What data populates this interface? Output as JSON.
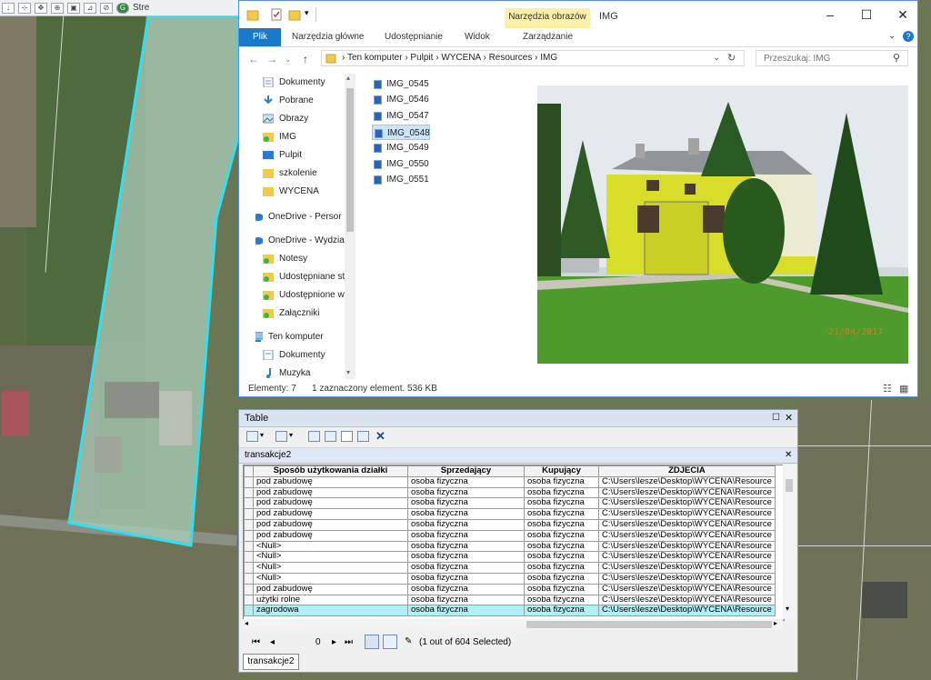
{
  "arcmap_toolbar": {
    "streetview_label": "Stre"
  },
  "explorer": {
    "title": "IMG",
    "context_tab": "Narzędzia obrazów",
    "ribbon_tabs": [
      "Plik",
      "Narzędzia główne",
      "Udostępnianie",
      "Widok",
      "Zarządzanie"
    ],
    "breadcrumb": [
      "Ten komputer",
      "Pulpit",
      "WYCENA",
      "Resources",
      "IMG"
    ],
    "search_placeholder": "Przeszukaj: IMG",
    "nav_items": [
      {
        "label": "Dokumenty",
        "icon": "documents-icon",
        "pinned": true
      },
      {
        "label": "Pobrane",
        "icon": "download-icon",
        "pinned": true
      },
      {
        "label": "Obrazy",
        "icon": "pictures-icon",
        "pinned": true
      },
      {
        "label": "IMG",
        "icon": "folder-sync-icon",
        "pinned": true
      },
      {
        "label": "Pulpit",
        "icon": "desktop-icon",
        "pinned": true
      },
      {
        "label": "szkolenie",
        "icon": "folder-icon",
        "pinned": false
      },
      {
        "label": "WYCENA",
        "icon": "folder-icon",
        "pinned": false
      },
      {
        "label": "OneDrive - Persor",
        "icon": "onedrive-icon",
        "pinned": false
      },
      {
        "label": "OneDrive - Wydzia",
        "icon": "onedrive-icon",
        "pinned": false
      },
      {
        "label": "Notesy",
        "icon": "folder-sync-icon",
        "pinned": false
      },
      {
        "label": "Udostępniane st",
        "icon": "folder-sync-icon",
        "pinned": false
      },
      {
        "label": "Udostępnione w",
        "icon": "folder-sync-icon",
        "pinned": false
      },
      {
        "label": "Załączniki",
        "icon": "folder-sync-icon",
        "pinned": false
      },
      {
        "label": "Ten komputer",
        "icon": "computer-icon",
        "pinned": false
      },
      {
        "label": "Dokumenty",
        "icon": "documents-icon",
        "pinned": false
      },
      {
        "label": "Muzyka",
        "icon": "music-icon",
        "pinned": false
      }
    ],
    "files": [
      "IMG_0545",
      "IMG_0546",
      "IMG_0547",
      "IMG_0548",
      "IMG_0549",
      "IMG_0550",
      "IMG_0551"
    ],
    "selected_file": "IMG_0548",
    "preview_date_stamp": "21/04/2017",
    "status_count": "Elementy: 7",
    "status_selected": "1 zaznaczony element. 536 KB"
  },
  "table_window": {
    "title": "Table",
    "layer_tab": "transakcje2",
    "columns": [
      "Sposób użytkowania działki",
      "Sprzedający",
      "Kupujący",
      "ZDJECIA"
    ],
    "rows": [
      [
        "pod zabudowę",
        "osoba fizyczna",
        "osoba fizyczna",
        "C:\\Users\\lesze\\Desktop\\WYCENA\\Resource"
      ],
      [
        "pod zabudowę",
        "osoba fizyczna",
        "osoba fizyczna",
        "C:\\Users\\lesze\\Desktop\\WYCENA\\Resource"
      ],
      [
        "pod zabudowę",
        "osoba fizyczna",
        "osoba fizyczna",
        "C:\\Users\\lesze\\Desktop\\WYCENA\\Resource"
      ],
      [
        "pod zabudowę",
        "osoba fizyczna",
        "osoba fizyczna",
        "C:\\Users\\lesze\\Desktop\\WYCENA\\Resource"
      ],
      [
        "pod zabudowę",
        "osoba fizyczna",
        "osoba fizyczna",
        "C:\\Users\\lesze\\Desktop\\WYCENA\\Resource"
      ],
      [
        "pod zabudowę",
        "osoba fizyczna",
        "osoba fizyczna",
        "C:\\Users\\lesze\\Desktop\\WYCENA\\Resource"
      ],
      [
        "<Null>",
        "osoba fizyczna",
        "osoba fizyczna",
        "C:\\Users\\lesze\\Desktop\\WYCENA\\Resource"
      ],
      [
        "<Null>",
        "osoba fizyczna",
        "osoba fizyczna",
        "C:\\Users\\lesze\\Desktop\\WYCENA\\Resource"
      ],
      [
        "<Null>",
        "osoba fizyczna",
        "osoba fizyczna",
        "C:\\Users\\lesze\\Desktop\\WYCENA\\Resource"
      ],
      [
        "<Null>",
        "osoba fizyczna",
        "osoba fizyczna",
        "C:\\Users\\lesze\\Desktop\\WYCENA\\Resource"
      ],
      [
        "pod zabudowę",
        "osoba fizyczna",
        "osoba fizyczna",
        "C:\\Users\\lesze\\Desktop\\WYCENA\\Resource"
      ],
      [
        "użytki rolne",
        "osoba fizyczna",
        "osoba fizyczna",
        "C:\\Users\\lesze\\Desktop\\WYCENA\\Resource"
      ],
      [
        "zagrodowa",
        "osoba fizyczna",
        "osoba fizyczna",
        "C:\\Users\\lesze\\Desktop\\WYCENA\\Resource"
      ]
    ],
    "selected_row_index": 12,
    "record_value": "0",
    "selection_status": "(1 out of 604 Selected)",
    "bottom_tab": "transakcje2"
  }
}
